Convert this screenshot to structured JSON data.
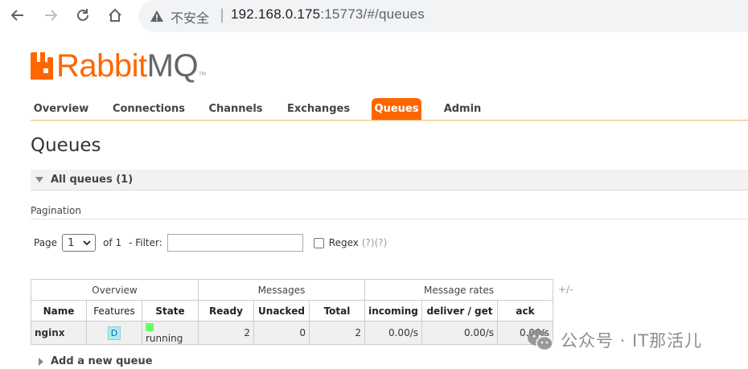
{
  "browser": {
    "insecure_label": "不安全",
    "separator": "|",
    "url_host": "192.168.0.175",
    "url_rest": ":15773/#/queues"
  },
  "app": {
    "logo_brand": "Rabbit",
    "logo_brand_mq": "MQ",
    "logo_tm": "TM",
    "brand_color": "#ff6600"
  },
  "tabs": [
    {
      "label": "Overview",
      "active": false
    },
    {
      "label": "Connections",
      "active": false
    },
    {
      "label": "Channels",
      "active": false
    },
    {
      "label": "Exchanges",
      "active": false
    },
    {
      "label": "Queues",
      "active": true
    },
    {
      "label": "Admin",
      "active": false
    }
  ],
  "page": {
    "title": "Queues",
    "section_title": "All queues (1)",
    "pagination_label": "Pagination",
    "pager": {
      "page_label": "Page",
      "page_value": "1",
      "of_label": "of 1",
      "filter_label": "- Filter:",
      "filter_value": "",
      "regex_label": "Regex",
      "help1": "(?)",
      "help2": "(?)"
    },
    "add_queue_label": "Add a new queue"
  },
  "table": {
    "groups": [
      "Overview",
      "Messages",
      "Message rates"
    ],
    "plusminus": "+/-",
    "columns": [
      "Name",
      "Features",
      "State",
      "Ready",
      "Unacked",
      "Total",
      "incoming",
      "deliver / get",
      "ack"
    ],
    "rows": [
      {
        "name": "nginx",
        "features": "D",
        "state": "running",
        "ready": "2",
        "unacked": "0",
        "total": "2",
        "incoming": "0.00/s",
        "deliver_get": "0.00/s",
        "ack": "0.00/s"
      }
    ]
  },
  "watermark": {
    "text": "公众号 · IT那活儿"
  }
}
